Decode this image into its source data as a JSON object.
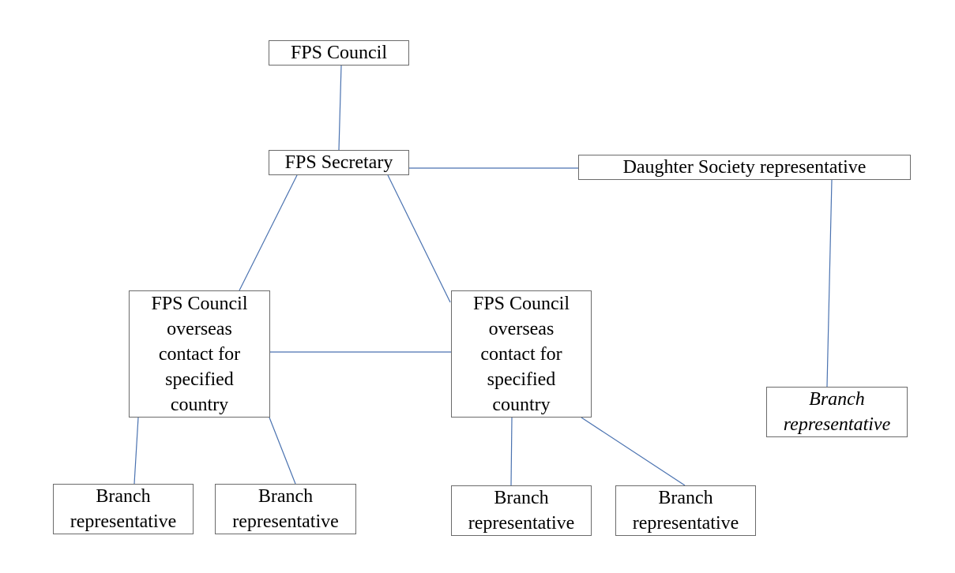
{
  "diagram": {
    "type": "organization-chart",
    "line_color": "#4a72b0",
    "border_color": "#6b6b6b",
    "nodes": {
      "council": {
        "lines": [
          "FPS Council"
        ],
        "italic": false
      },
      "secretary": {
        "lines": [
          "FPS Secretary"
        ],
        "italic": false
      },
      "daughter": {
        "lines": [
          "Daughter Society representative"
        ],
        "italic": false
      },
      "overseas_a": {
        "lines": [
          "FPS Council",
          "overseas",
          "contact for",
          "specified",
          "country"
        ],
        "italic": false
      },
      "overseas_b": {
        "lines": [
          "FPS Council",
          "overseas",
          "contact for",
          "specified",
          "country"
        ],
        "italic": false
      },
      "branch_ds": {
        "lines": [
          "Branch",
          "representative"
        ],
        "italic": true
      },
      "branch_a1": {
        "lines": [
          "Branch",
          "representative"
        ],
        "italic": false
      },
      "branch_a2": {
        "lines": [
          "Branch",
          "representative"
        ],
        "italic": false
      },
      "branch_b1": {
        "lines": [
          "Branch",
          "representative"
        ],
        "italic": false
      },
      "branch_b2": {
        "lines": [
          "Branch",
          "representative"
        ],
        "italic": false
      }
    },
    "edges": [
      {
        "from": "council",
        "to": "secretary"
      },
      {
        "from": "secretary",
        "to": "daughter"
      },
      {
        "from": "secretary",
        "to": "overseas_a"
      },
      {
        "from": "secretary",
        "to": "overseas_b"
      },
      {
        "from": "overseas_a",
        "to": "overseas_b"
      },
      {
        "from": "daughter",
        "to": "branch_ds"
      },
      {
        "from": "overseas_a",
        "to": "branch_a1"
      },
      {
        "from": "overseas_a",
        "to": "branch_a2"
      },
      {
        "from": "overseas_b",
        "to": "branch_b1"
      },
      {
        "from": "overseas_b",
        "to": "branch_b2"
      }
    ]
  }
}
